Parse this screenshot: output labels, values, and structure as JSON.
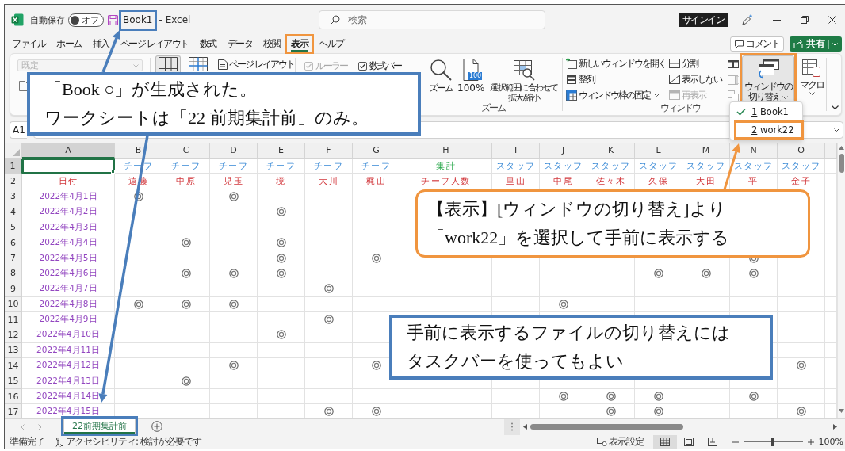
{
  "title_bar": {
    "autosave": {
      "label": "自動保存",
      "state_label": "オフ",
      "on": false
    },
    "document": {
      "name": "Book1",
      "highlight": {
        "color": "#4a7ebb"
      }
    },
    "app": "- Excel",
    "search": {
      "placeholder": "検索"
    },
    "sign_in": "サインイン"
  },
  "menu": {
    "tabs": [
      {
        "label": "ファイル",
        "selected": false
      },
      {
        "label": "ホーム",
        "selected": false
      },
      {
        "label": "挿入",
        "selected": false
      },
      {
        "label": "ページ レイアウト",
        "selected": false
      },
      {
        "label": "数式",
        "selected": false
      },
      {
        "label": "データ",
        "selected": false
      },
      {
        "label": "校閲",
        "selected": false
      },
      {
        "label": "表示",
        "selected": true,
        "highlight": {
          "color": "#f0953f"
        }
      },
      {
        "label": "ヘルプ",
        "selected": false
      }
    ],
    "comment": "コメント",
    "share": "共有"
  },
  "ribbon": {
    "style_box": {
      "value": "既定",
      "disabled": true
    },
    "views": [
      {
        "kind": "normal",
        "selected": true
      },
      {
        "kind": "page_break",
        "selected": false
      }
    ],
    "page_layout": "ページ レイアウト",
    "show": [
      {
        "label": "ルーラー",
        "checked": true,
        "disabled": true
      },
      {
        "label": "数式バー",
        "checked": true,
        "disabled": false
      }
    ],
    "zoom_group": {
      "buttons": [
        {
          "kind": "zoom",
          "label": "ズーム"
        },
        {
          "kind": "actual_size",
          "label": "100%",
          "badge": "100"
        },
        {
          "kind": "fit",
          "label": "選択範囲に合わせて拡大/縮小"
        }
      ],
      "label": "ズーム"
    },
    "window_group": {
      "left_commands": [
        {
          "kind": "new_window",
          "label": "新しいウィンドウを開く",
          "disabled": false
        },
        {
          "kind": "arrange",
          "label": "整列",
          "disabled": false
        },
        {
          "kind": "freeze",
          "label": "ウィンドウ枠の固定",
          "disabled": false
        }
      ],
      "right_commands": [
        {
          "kind": "split",
          "label": "分割",
          "disabled": false
        },
        {
          "kind": "hide",
          "label": "表示しない",
          "disabled": false
        },
        {
          "kind": "unhide",
          "label": "再表示",
          "disabled": true
        }
      ],
      "tools": [
        {
          "kind": "side_by_side",
          "disabled": false
        },
        {
          "kind": "sync_scroll",
          "disabled": true
        },
        {
          "kind": "reset_position",
          "disabled": true
        }
      ],
      "switch": {
        "label": "ウィンドウの切り替え",
        "expanded": true,
        "highlight": {
          "color": "#f0953f"
        }
      },
      "label": "ウィンドウ"
    },
    "macro": {
      "label": "マクロ"
    }
  },
  "window_menu": {
    "items": [
      {
        "label": "1 Book1",
        "selected": true
      },
      {
        "label": "2 work22",
        "selected": false,
        "highlight": {
          "color": "#f0953f"
        }
      }
    ]
  },
  "formula_bar": {
    "name_box": "A1"
  },
  "sheet": {
    "columns": [
      {
        "label": "A",
        "selected": true
      },
      {
        "label": "B",
        "selected": false
      },
      {
        "label": "C",
        "selected": false
      },
      {
        "label": "D",
        "selected": false
      },
      {
        "label": "E",
        "selected": false
      },
      {
        "label": "F",
        "selected": false
      },
      {
        "label": "G",
        "selected": false
      },
      {
        "label": "H",
        "selected": false
      },
      {
        "label": "I",
        "selected": false
      },
      {
        "label": "J",
        "selected": false
      },
      {
        "label": "K",
        "selected": false
      },
      {
        "label": "L",
        "selected": false
      },
      {
        "label": "M",
        "selected": false
      },
      {
        "label": "N",
        "selected": false
      },
      {
        "label": "O",
        "selected": false
      }
    ],
    "title_row": {
      "number": "1",
      "selected": true,
      "labels": [
        {
          "text": "チーフ",
          "kind": "team"
        },
        {
          "text": "チーフ",
          "kind": "team"
        },
        {
          "text": "チーフ",
          "kind": "team"
        },
        {
          "text": "チーフ",
          "kind": "team"
        },
        {
          "text": "チーフ",
          "kind": "team"
        },
        {
          "text": "チーフ",
          "kind": "team"
        },
        {
          "text": "集計",
          "kind": "total"
        },
        {
          "text": "スタッフ",
          "kind": "team"
        },
        {
          "text": "スタッフ",
          "kind": "team"
        },
        {
          "text": "スタッフ",
          "kind": "team"
        },
        {
          "text": "スタッフ",
          "kind": "team"
        },
        {
          "text": "スタッフ",
          "kind": "team"
        },
        {
          "text": "スタッフ",
          "kind": "team"
        },
        {
          "text": "スタッフ",
          "kind": "team"
        }
      ]
    },
    "name_row": {
      "number": "2",
      "selected": false,
      "first": "日付",
      "labels": [
        "遠藤",
        "中原",
        "児玉",
        "境",
        "大川",
        "梶山",
        "チーフ人数",
        "里山",
        "中尾",
        "佐々木",
        "久保",
        "大田",
        "平",
        "金子"
      ]
    },
    "rows": [
      {
        "number": "3",
        "selected": false,
        "date": "2022年4月1日",
        "marks": [
          true,
          false,
          true,
          false,
          false,
          false,
          false,
          false,
          false,
          false,
          false,
          false,
          false,
          false
        ]
      },
      {
        "number": "4",
        "selected": false,
        "date": "2022年4月2日",
        "marks": [
          false,
          false,
          false,
          true,
          false,
          false,
          false,
          false,
          false,
          false,
          false,
          false,
          false,
          false
        ]
      },
      {
        "number": "5",
        "selected": false,
        "date": "2022年4月3日",
        "marks": [
          false,
          false,
          false,
          false,
          false,
          false,
          false,
          false,
          false,
          false,
          false,
          false,
          false,
          false
        ]
      },
      {
        "number": "6",
        "selected": false,
        "date": "2022年4月4日",
        "marks": [
          false,
          true,
          false,
          true,
          false,
          false,
          false,
          false,
          false,
          false,
          false,
          false,
          false,
          false
        ]
      },
      {
        "number": "7",
        "selected": false,
        "date": "2022年4月5日",
        "marks": [
          false,
          false,
          false,
          true,
          false,
          true,
          false,
          false,
          false,
          false,
          false,
          false,
          true,
          false
        ]
      },
      {
        "number": "8",
        "selected": false,
        "date": "2022年4月6日",
        "marks": [
          false,
          true,
          true,
          true,
          false,
          false,
          false,
          false,
          false,
          false,
          true,
          true,
          true,
          false
        ]
      },
      {
        "number": "9",
        "selected": false,
        "date": "2022年4月7日",
        "marks": [
          false,
          false,
          false,
          false,
          true,
          false,
          false,
          false,
          false,
          false,
          false,
          false,
          false,
          false
        ]
      },
      {
        "number": "10",
        "selected": false,
        "date": "2022年4月8日",
        "marks": [
          true,
          true,
          true,
          false,
          false,
          false,
          false,
          false,
          true,
          false,
          false,
          false,
          false,
          false
        ]
      },
      {
        "number": "11",
        "selected": false,
        "date": "2022年4月9日",
        "marks": [
          false,
          false,
          false,
          false,
          true,
          false,
          false,
          false,
          false,
          false,
          false,
          false,
          false,
          false
        ]
      },
      {
        "number": "12",
        "selected": false,
        "date": "2022年4月10日",
        "marks": [
          false,
          false,
          false,
          true,
          false,
          false,
          false,
          false,
          false,
          false,
          false,
          false,
          false,
          false
        ]
      },
      {
        "number": "13",
        "selected": false,
        "date": "2022年4月11日",
        "marks": [
          false,
          false,
          false,
          false,
          false,
          false,
          false,
          false,
          false,
          false,
          false,
          false,
          false,
          false
        ]
      },
      {
        "number": "14",
        "selected": false,
        "date": "2022年4月12日",
        "marks": [
          false,
          false,
          true,
          false,
          false,
          true,
          false,
          false,
          false,
          false,
          false,
          false,
          false,
          true
        ]
      },
      {
        "number": "15",
        "selected": false,
        "date": "2022年4月13日",
        "marks": [
          false,
          true,
          false,
          false,
          false,
          false,
          false,
          false,
          false,
          false,
          false,
          false,
          false,
          false
        ]
      },
      {
        "number": "16",
        "selected": false,
        "date": "2022年4月14日",
        "marks": [
          false,
          false,
          false,
          false,
          false,
          false,
          false,
          false,
          true,
          true,
          true,
          false,
          true,
          false
        ]
      },
      {
        "number": "17",
        "selected": false,
        "date": "2022年4月15日",
        "marks": [
          false,
          false,
          false,
          false,
          true,
          true,
          false,
          false,
          false,
          true,
          true,
          false,
          false,
          true
        ]
      }
    ]
  },
  "sheet_tabs": {
    "tabs": [
      {
        "label": "22前期集計前",
        "selected": true,
        "highlight": {
          "color": "#4a7ebb"
        }
      }
    ]
  },
  "status_bar": {
    "ready": "準備完了",
    "accessibility": "アクセシビリティ: 検討が必要です",
    "display_settings": "表示設定",
    "views": [
      {
        "kind": "normal",
        "selected": true
      },
      {
        "kind": "page_layout",
        "selected": false
      },
      {
        "kind": "page_break",
        "selected": false
      }
    ],
    "zoom": {
      "level": 0.5,
      "reading": "100%"
    }
  },
  "callouts": [
    {
      "kind": "box",
      "color": "#4a7ebb",
      "lines": [
        "「Book ○」が生成された。",
        "ワークシートは「22 前期集計前」のみ。"
      ],
      "pointers": [
        {
          "kind": "title"
        },
        {
          "kind": "sheet_tab"
        }
      ]
    },
    {
      "kind": "rounded",
      "color": "#f0953f",
      "lines": [
        "【表示】[ウィンドウの切り替え]より",
        "「work22」を選択して手前に表示する"
      ],
      "pointers": [
        {
          "kind": "window_menu"
        }
      ]
    },
    {
      "kind": "box",
      "color": "#4a7ebb",
      "lines": [
        "手前に表示するファイルの切り替えには",
        "タスクバーを使ってもよい"
      ]
    }
  ]
}
